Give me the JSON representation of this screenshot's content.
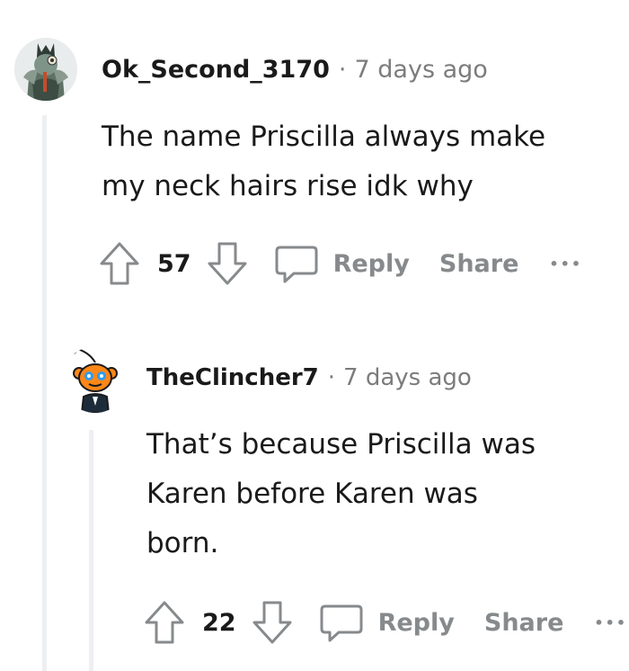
{
  "comments": [
    {
      "author": "Ok_Second_3170",
      "separator": "·",
      "time": "7 days ago",
      "body_lines": [
        "The name Priscilla always make",
        "my neck hairs rise idk why"
      ],
      "score": "57",
      "reply_label": "Reply",
      "share_label": "Share",
      "more_label": "•••"
    },
    {
      "author": "TheClincher7",
      "separator": "·",
      "time": "7 days ago",
      "body_lines": [
        "That’s because Priscilla was",
        "Karen before Karen was",
        "born."
      ],
      "score": "22",
      "reply_label": "Reply",
      "share_label": "Share",
      "more_label": "•••"
    }
  ],
  "colors": {
    "text": "#1a1a1b",
    "meta": "#7c7c7c",
    "action": "#878a8c",
    "thread_line": "#edeff1",
    "snoo_orange": "#ff8717"
  }
}
